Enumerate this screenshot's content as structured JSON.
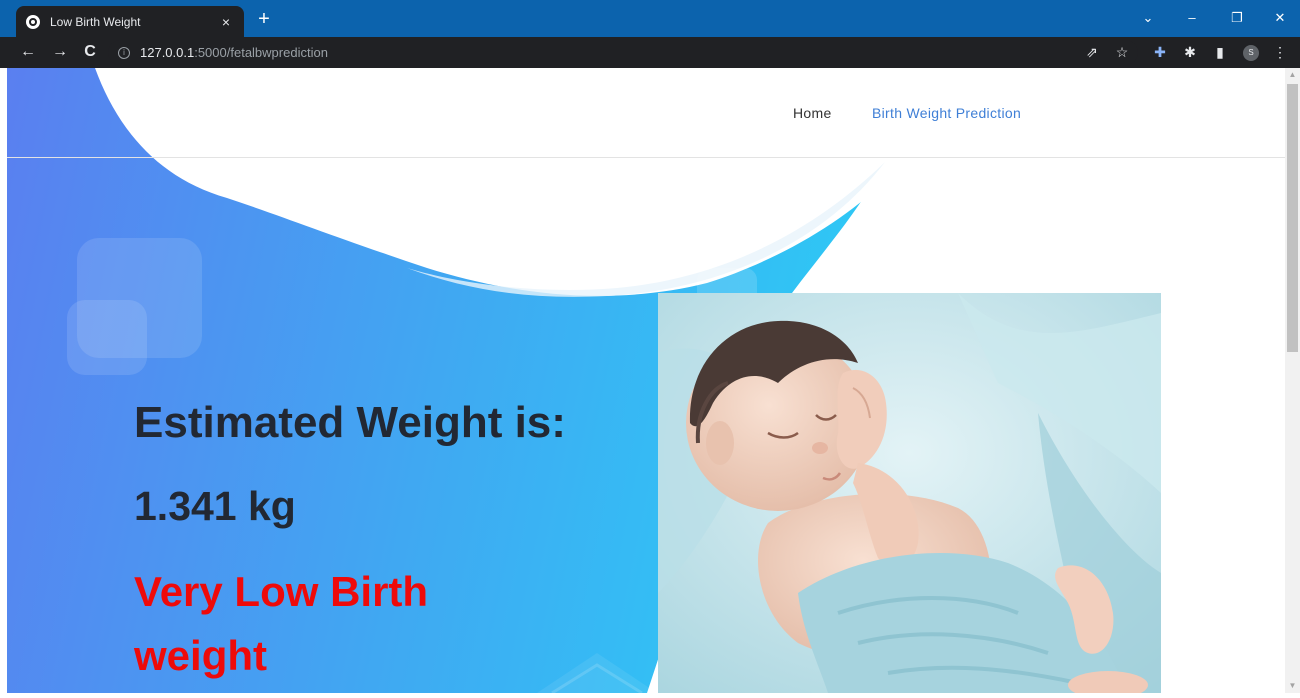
{
  "browser": {
    "tab_title": "Low Birth Weight",
    "tab_close": "×",
    "new_tab": "+",
    "url_host": "127.0.0.1",
    "url_path": ":5000/fetalbwprediction",
    "window_controls": {
      "minimize": "–",
      "restore": "❐",
      "close": "✕",
      "tab_search": "⌄"
    },
    "nav": {
      "back": "←",
      "forward": "→",
      "reload": "C"
    },
    "toolbar_icons": {
      "share": "⇗",
      "bookmark": "☆",
      "extension": "✚",
      "puzzle": "✱",
      "sidepanel": "▮",
      "menu": "⋮"
    },
    "profile_label": "S"
  },
  "navbar": {
    "home": "Home",
    "birth_weight_prediction": "Birth Weight Prediction"
  },
  "result": {
    "heading": "Estimated Weight is:",
    "value": "1.341 kg",
    "category": "Very Low Birth weight"
  },
  "colors": {
    "gradient_start": "#5a7ff0",
    "gradient_end": "#2ec8f5",
    "category_text": "#ee0a0a",
    "nav_active": "#3f7fd6",
    "chrome_titlebar": "#0c63ad"
  }
}
